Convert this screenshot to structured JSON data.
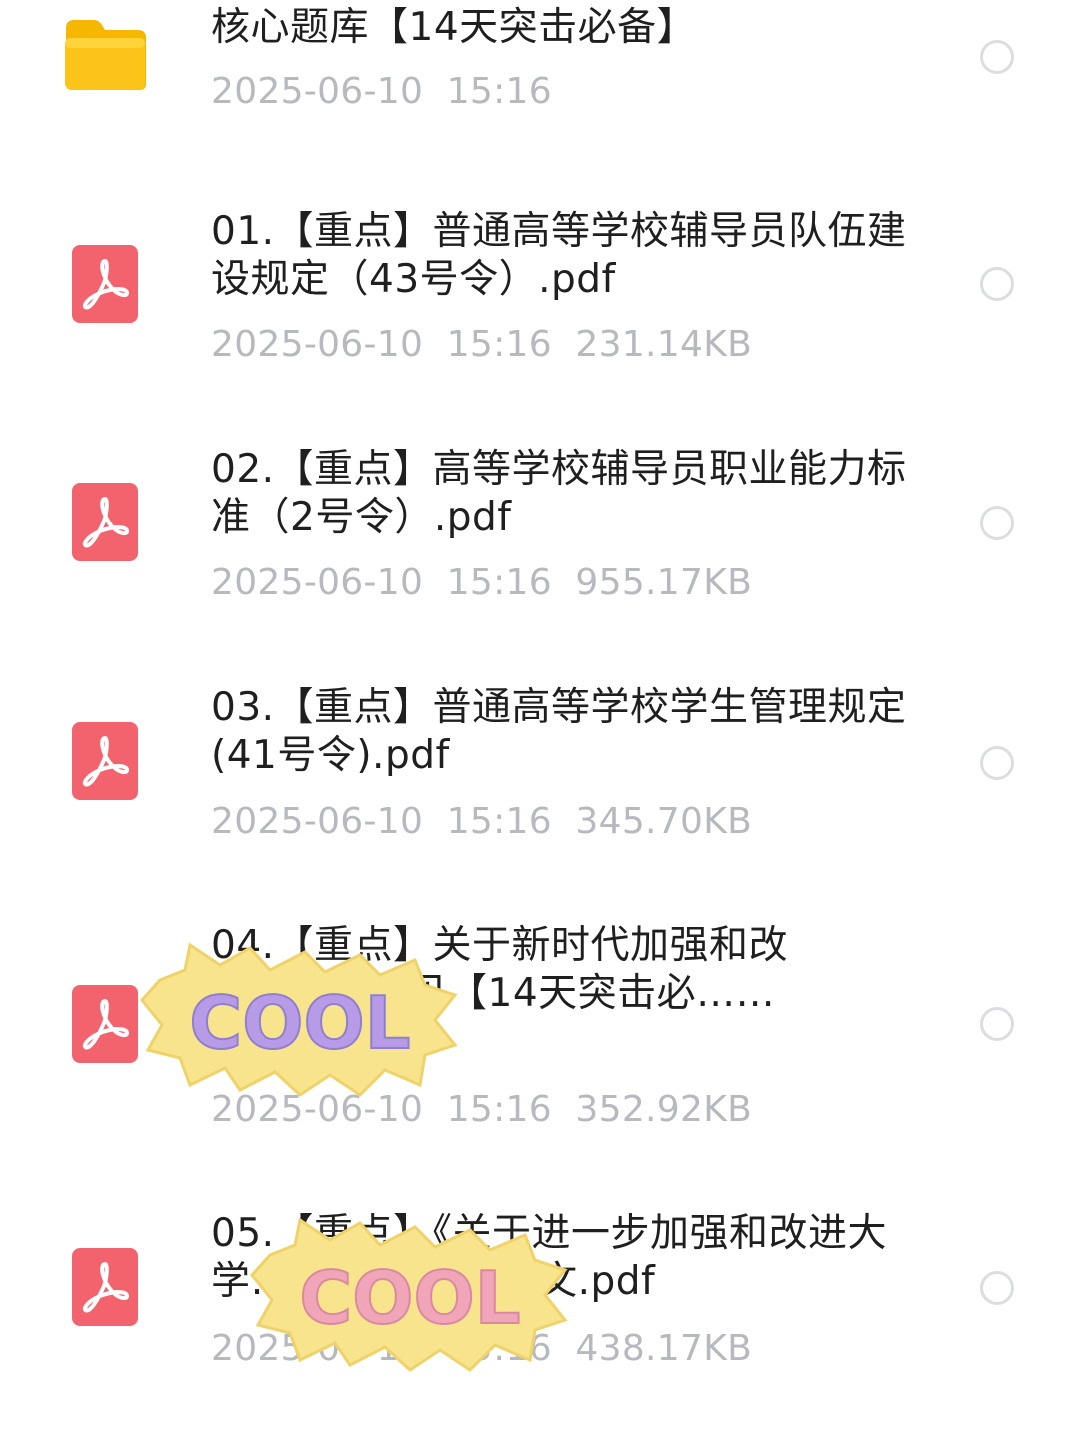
{
  "files": [
    {
      "type": "folder",
      "name": "核心题库【14天突击必备】",
      "meta": "2025-06-10  15:16"
    },
    {
      "type": "pdf",
      "name": "01.【重点】普通高等学校辅导员队伍建设规定（43号令）.pdf",
      "meta": "2025-06-10  15:16  231.14KB"
    },
    {
      "type": "pdf",
      "name": "02.【重点】高等学校辅导员职业能力标准（2号令）.pdf",
      "meta": "2025-06-10  15:16  955.17KB"
    },
    {
      "type": "pdf",
      "name": "03.【重点】普通高等学校学生管理规定(41号令).pdf",
      "meta": "2025-06-10  15:16  345.70KB"
    },
    {
      "type": "pdf",
      "name": "04.【重点】关于新时代加强和改进……的意见【14天突击必……",
      "meta": "2025-06-10  15:16  352.92KB"
    },
    {
      "type": "pdf",
      "name": "05.【重点】《关于进一步加强和改进大学……意见》16号文.pdf",
      "meta": "2025-06-10  15:16  438.17KB"
    }
  ],
  "stickers": [
    {
      "text": "COOL"
    },
    {
      "text": "COOL"
    }
  ],
  "colors": {
    "pdf_icon": "#f2636e",
    "folder_icon": "#fcc419",
    "title_text": "#1f1f1f",
    "meta_text": "#b7b9bf",
    "radio_border": "#dcdde0",
    "sticker_base": "#f8e48c"
  }
}
